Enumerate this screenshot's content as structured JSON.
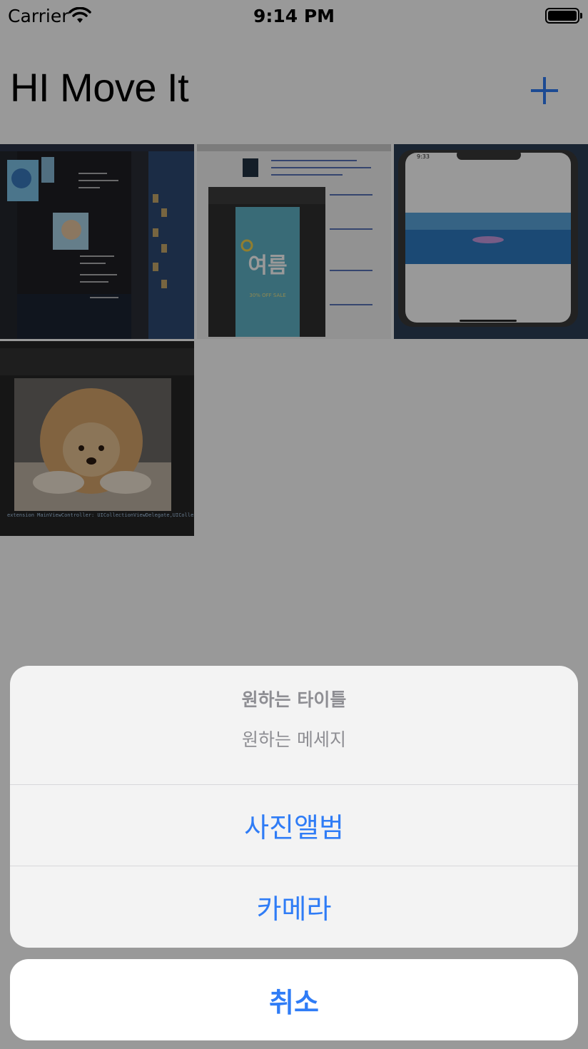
{
  "status_bar": {
    "carrier": "Carrier",
    "time": "9:14 PM",
    "icons": [
      "wifi-icon",
      "battery-icon"
    ]
  },
  "nav": {
    "title": "HI Move It",
    "add_icon": "plus-icon"
  },
  "grid": {
    "thumbnails": [
      {
        "name": "xcode-screenshot-thumbnail"
      },
      {
        "name": "summer-sale-poster-thumbnail",
        "text_big": "여름",
        "text_small": "30% OFF SALE"
      },
      {
        "name": "iphone-simulator-thumbnail",
        "time": "9:33"
      },
      {
        "name": "pomeranian-dog-thumbnail",
        "code_line": "extension MainViewController: UICollectionViewDelegate,UICollectionViewData"
      }
    ]
  },
  "action_sheet": {
    "title": "원하는 타이틀",
    "message": "원하는 메세지",
    "actions": [
      {
        "label": "사진앨범"
      },
      {
        "label": "카메라"
      }
    ],
    "cancel_label": "취소"
  },
  "colors": {
    "accent": "#2f7cf6",
    "dim_overlay": "rgba(0,0,0,0.40)",
    "sheet_bg": "#f3f3f3",
    "secondary_text": "#8e8e93"
  }
}
